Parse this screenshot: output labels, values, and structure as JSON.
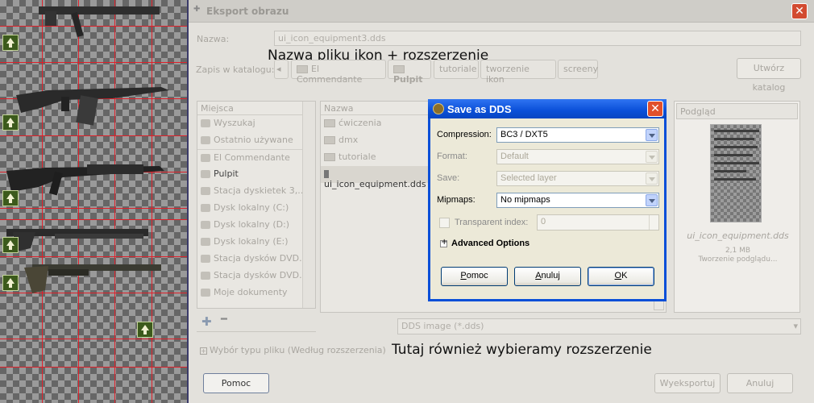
{
  "main_dialog": {
    "title": "Eksport obrazu",
    "name_label": "Nazwa:",
    "name_value": "ui_icon_equipment3.dds",
    "save_in_label": "Zapis w katalogu:",
    "breadcrumbs": [
      "El Commendante",
      "Pulpit",
      "tutoriale",
      "tworzenie ikon",
      "screeny"
    ],
    "create_folder_button": "Utwórz katalog",
    "places_header": "Miejsca",
    "places": [
      {
        "label": "Wyszukaj",
        "icon": "search-icon"
      },
      {
        "label": "Ostatnio używane",
        "icon": "clock-icon"
      },
      {
        "label": "El Commendante",
        "icon": "folder-icon"
      },
      {
        "label": "Pulpit",
        "icon": "folder-icon"
      },
      {
        "label": "Stacja dyskietek 3,...",
        "icon": "floppy-icon"
      },
      {
        "label": "Dysk lokalny (C:)",
        "icon": "disk-icon"
      },
      {
        "label": "Dysk lokalny (D:)",
        "icon": "disk-icon"
      },
      {
        "label": "Dysk lokalny (E:)",
        "icon": "disk-icon"
      },
      {
        "label": "Stacja dysków DVD...",
        "icon": "dvd-icon"
      },
      {
        "label": "Stacja dysków DVD...",
        "icon": "dvd-icon"
      },
      {
        "label": "Moje dokumenty",
        "icon": "folder-icon"
      }
    ],
    "files_header": "Nazwa",
    "files": [
      {
        "label": "ćwiczenia",
        "icon": "folder-icon"
      },
      {
        "label": "dmx",
        "icon": "folder-icon"
      },
      {
        "label": "tutoriale",
        "icon": "folder-icon"
      },
      {
        "label": "ui_icon_equipment.dds",
        "icon": "file-icon"
      }
    ],
    "preview_header": "Podgląd",
    "preview_filename": "ui_icon_equipment.dds",
    "preview_size": "2,1 MB",
    "preview_status": "Tworzenie podglądu...",
    "file_type_value": "DDS image (*.dds)",
    "file_type_expander": "Wybór typu pliku (Według rozszerzenia)",
    "help_button": "Pomoc",
    "export_button": "Wyeksportuj",
    "cancel_button": "Anuluj"
  },
  "annotations": {
    "filename_note": "Nazwa pliku ikon + rozszerzenie",
    "extension_note": "Tutaj również wybieramy rozszerzenie"
  },
  "dds_dialog": {
    "title": "Save as DDS",
    "compression_label": "Compression:",
    "compression_value": "BC3 / DXT5",
    "format_label": "Format:",
    "format_value": "Default",
    "save_label": "Save:",
    "save_value": "Selected layer",
    "mipmaps_label": "Mipmaps:",
    "mipmaps_value": "No mipmaps",
    "transparent_label": "Transparent index:",
    "transparent_value": "0",
    "advanced_label": "Advanced Options",
    "help_button": "Pomoc",
    "cancel_button": "Anuluj",
    "ok_button": "OK"
  },
  "colors": {
    "xp_titlebar": "#0a4fd8",
    "grid_line": "#e0202a",
    "close_button": "#d24a30"
  }
}
